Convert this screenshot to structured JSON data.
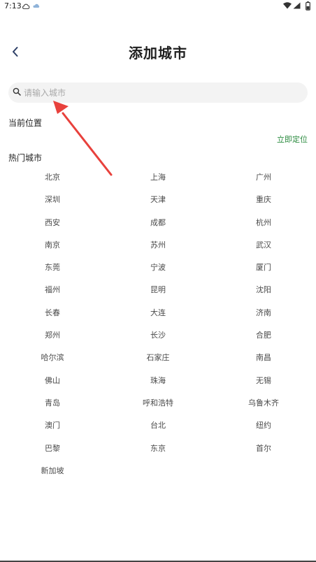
{
  "status_bar": {
    "time": "7:13"
  },
  "header": {
    "title": "添加城市",
    "back_icon": "chevron-left-icon"
  },
  "search": {
    "placeholder": "请输入城市",
    "value": "",
    "icon": "search-icon"
  },
  "current_location": {
    "label": "当前位置",
    "locate_label": "立即定位"
  },
  "hot_cities": {
    "label": "热门城市",
    "items": [
      "北京",
      "上海",
      "广州",
      "深圳",
      "天津",
      "重庆",
      "西安",
      "成都",
      "杭州",
      "南京",
      "苏州",
      "武汉",
      "东莞",
      "宁波",
      "厦门",
      "福州",
      "昆明",
      "沈阳",
      "长春",
      "大连",
      "济南",
      "郑州",
      "长沙",
      "合肥",
      "哈尔滨",
      "石家庄",
      "南昌",
      "佛山",
      "珠海",
      "无锡",
      "青岛",
      "呼和浩特",
      "乌鲁木齐",
      "澳门",
      "台北",
      "纽约",
      "巴黎",
      "东京",
      "首尔",
      "新加坡"
    ]
  },
  "colors": {
    "accent_green": "#2a8a3e",
    "annotation_red": "#e8413c",
    "search_bg": "#f3f3f3",
    "title_text": "#1f1f1f"
  }
}
